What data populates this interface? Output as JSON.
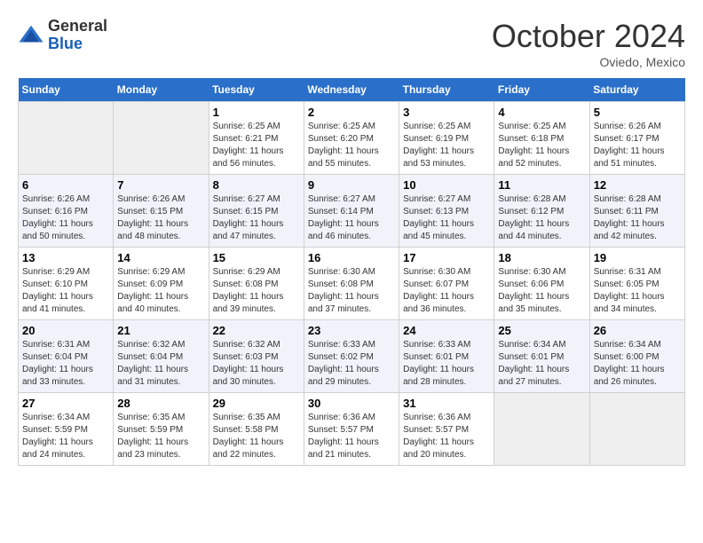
{
  "header": {
    "logo_general": "General",
    "logo_blue": "Blue",
    "month": "October 2024",
    "location": "Oviedo, Mexico"
  },
  "weekdays": [
    "Sunday",
    "Monday",
    "Tuesday",
    "Wednesday",
    "Thursday",
    "Friday",
    "Saturday"
  ],
  "weeks": [
    [
      {
        "day": "",
        "empty": true
      },
      {
        "day": "",
        "empty": true
      },
      {
        "day": "1",
        "sunrise": "6:25 AM",
        "sunset": "6:21 PM",
        "daylight": "11 hours and 56 minutes."
      },
      {
        "day": "2",
        "sunrise": "6:25 AM",
        "sunset": "6:20 PM",
        "daylight": "11 hours and 55 minutes."
      },
      {
        "day": "3",
        "sunrise": "6:25 AM",
        "sunset": "6:19 PM",
        "daylight": "11 hours and 53 minutes."
      },
      {
        "day": "4",
        "sunrise": "6:25 AM",
        "sunset": "6:18 PM",
        "daylight": "11 hours and 52 minutes."
      },
      {
        "day": "5",
        "sunrise": "6:26 AM",
        "sunset": "6:17 PM",
        "daylight": "11 hours and 51 minutes."
      }
    ],
    [
      {
        "day": "6",
        "sunrise": "6:26 AM",
        "sunset": "6:16 PM",
        "daylight": "11 hours and 50 minutes."
      },
      {
        "day": "7",
        "sunrise": "6:26 AM",
        "sunset": "6:15 PM",
        "daylight": "11 hours and 48 minutes."
      },
      {
        "day": "8",
        "sunrise": "6:27 AM",
        "sunset": "6:15 PM",
        "daylight": "11 hours and 47 minutes."
      },
      {
        "day": "9",
        "sunrise": "6:27 AM",
        "sunset": "6:14 PM",
        "daylight": "11 hours and 46 minutes."
      },
      {
        "day": "10",
        "sunrise": "6:27 AM",
        "sunset": "6:13 PM",
        "daylight": "11 hours and 45 minutes."
      },
      {
        "day": "11",
        "sunrise": "6:28 AM",
        "sunset": "6:12 PM",
        "daylight": "11 hours and 44 minutes."
      },
      {
        "day": "12",
        "sunrise": "6:28 AM",
        "sunset": "6:11 PM",
        "daylight": "11 hours and 42 minutes."
      }
    ],
    [
      {
        "day": "13",
        "sunrise": "6:29 AM",
        "sunset": "6:10 PM",
        "daylight": "11 hours and 41 minutes."
      },
      {
        "day": "14",
        "sunrise": "6:29 AM",
        "sunset": "6:09 PM",
        "daylight": "11 hours and 40 minutes."
      },
      {
        "day": "15",
        "sunrise": "6:29 AM",
        "sunset": "6:08 PM",
        "daylight": "11 hours and 39 minutes."
      },
      {
        "day": "16",
        "sunrise": "6:30 AM",
        "sunset": "6:08 PM",
        "daylight": "11 hours and 37 minutes."
      },
      {
        "day": "17",
        "sunrise": "6:30 AM",
        "sunset": "6:07 PM",
        "daylight": "11 hours and 36 minutes."
      },
      {
        "day": "18",
        "sunrise": "6:30 AM",
        "sunset": "6:06 PM",
        "daylight": "11 hours and 35 minutes."
      },
      {
        "day": "19",
        "sunrise": "6:31 AM",
        "sunset": "6:05 PM",
        "daylight": "11 hours and 34 minutes."
      }
    ],
    [
      {
        "day": "20",
        "sunrise": "6:31 AM",
        "sunset": "6:04 PM",
        "daylight": "11 hours and 33 minutes."
      },
      {
        "day": "21",
        "sunrise": "6:32 AM",
        "sunset": "6:04 PM",
        "daylight": "11 hours and 31 minutes."
      },
      {
        "day": "22",
        "sunrise": "6:32 AM",
        "sunset": "6:03 PM",
        "daylight": "11 hours and 30 minutes."
      },
      {
        "day": "23",
        "sunrise": "6:33 AM",
        "sunset": "6:02 PM",
        "daylight": "11 hours and 29 minutes."
      },
      {
        "day": "24",
        "sunrise": "6:33 AM",
        "sunset": "6:01 PM",
        "daylight": "11 hours and 28 minutes."
      },
      {
        "day": "25",
        "sunrise": "6:34 AM",
        "sunset": "6:01 PM",
        "daylight": "11 hours and 27 minutes."
      },
      {
        "day": "26",
        "sunrise": "6:34 AM",
        "sunset": "6:00 PM",
        "daylight": "11 hours and 26 minutes."
      }
    ],
    [
      {
        "day": "27",
        "sunrise": "6:34 AM",
        "sunset": "5:59 PM",
        "daylight": "11 hours and 24 minutes."
      },
      {
        "day": "28",
        "sunrise": "6:35 AM",
        "sunset": "5:59 PM",
        "daylight": "11 hours and 23 minutes."
      },
      {
        "day": "29",
        "sunrise": "6:35 AM",
        "sunset": "5:58 PM",
        "daylight": "11 hours and 22 minutes."
      },
      {
        "day": "30",
        "sunrise": "6:36 AM",
        "sunset": "5:57 PM",
        "daylight": "11 hours and 21 minutes."
      },
      {
        "day": "31",
        "sunrise": "6:36 AM",
        "sunset": "5:57 PM",
        "daylight": "11 hours and 20 minutes."
      },
      {
        "day": "",
        "empty": true
      },
      {
        "day": "",
        "empty": true
      }
    ]
  ],
  "labels": {
    "sunrise": "Sunrise: ",
    "sunset": "Sunset: ",
    "daylight": "Daylight: "
  }
}
